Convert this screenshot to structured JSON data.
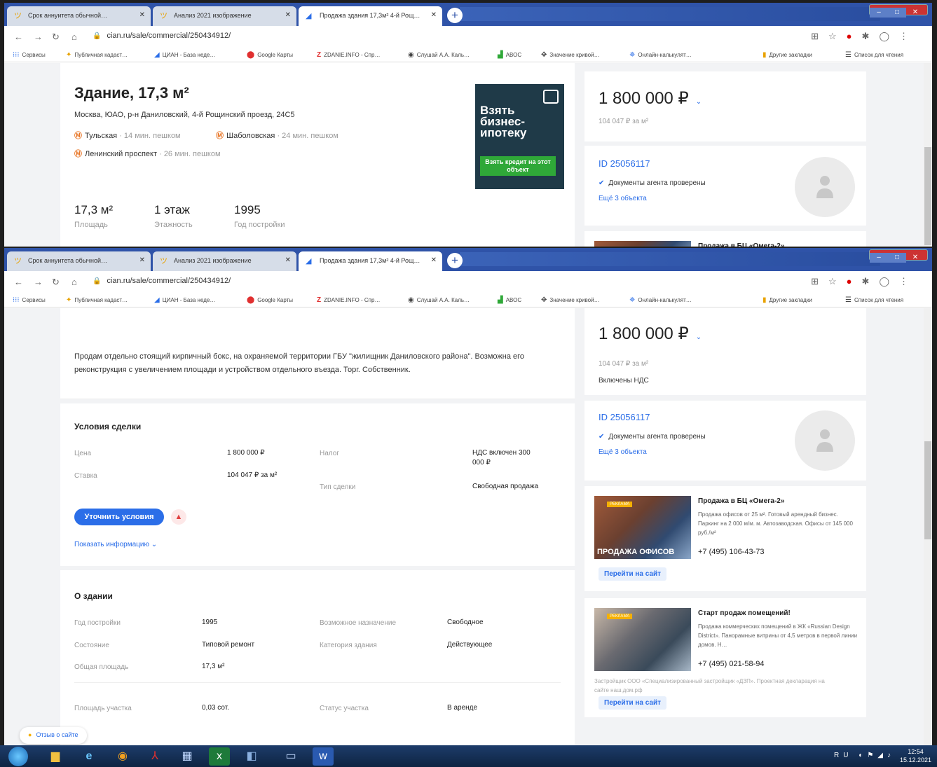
{
  "browser": {
    "tabs": [
      {
        "title": "Срок аннуитета обычной…",
        "icon": "yandex-icon"
      },
      {
        "title": "Анализ 2021 изображение",
        "icon": "yandex-icon"
      },
      {
        "title": "Продажа здания 17,3м² 4-й Рощ…",
        "icon": "cian-icon"
      }
    ],
    "address": "cian.ru/sale/commercial/250434912/",
    "bookmarks": [
      "Сервисы",
      "Публичная кадаст…",
      "ЦИАН - База неде…",
      "Google Карты",
      "ZDANIE.INFO - Спр…",
      "Слушай А.А. Каль…",
      "АВОС",
      "Значение кривой…",
      "Онлайн-калькулят…",
      "Другие закладки",
      "Список для чтения"
    ]
  },
  "listing": {
    "title": "Здание, 17,3 м²",
    "address": "Москва, ЮАО, р-н Даниловский, 4-й Рощинский проезд, 24С5",
    "metro": [
      {
        "name": "Тульская",
        "time": "· 14 мин. пешком"
      },
      {
        "name": "Шаболовская",
        "time": "· 24 мин. пешком"
      },
      {
        "name": "Ленинский проспект",
        "time": "· 26 мин. пешком"
      }
    ],
    "facts": [
      {
        "value": "17,3 м²",
        "label": "Площадь"
      },
      {
        "value": "1 этаж",
        "label": "Этажность"
      },
      {
        "value": "1995",
        "label": "Год постройки"
      }
    ],
    "description": "Продам отдельно стоящий кирпичный бокс, на охраняемой территории ГБУ \"жилищник Даниловского района\". Возможна его реконструкция с увеличением площади и устройством отдельного въезда. Торг. Собственник."
  },
  "ad_banner": {
    "text": "Взять бизнес-ипотеку",
    "button": "Взять кредит на этот объект"
  },
  "price_card": {
    "price": "1 800 000 ₽",
    "per_m2": "104 047 ₽ за м²",
    "vat": "Включены НДС",
    "id": "ID 25056117",
    "verified": "Документы агента проверены",
    "more": "Ещё 3 объекта"
  },
  "deal": {
    "title": "Условия сделки",
    "rows": [
      {
        "label": "Цена",
        "value": "1 800 000 ₽"
      },
      {
        "label": "Ставка",
        "value": "104 047 ₽ за м²"
      },
      {
        "label": "Налог",
        "value": "НДС включен 300 000 ₽"
      },
      {
        "label": "Тип сделки",
        "value": "Свободная продажа"
      }
    ],
    "button": "Уточнить условия",
    "show_more": "Показать информацию ⌄"
  },
  "building": {
    "title": "О здании",
    "rows": [
      {
        "label": "Год постройки",
        "value": "1995"
      },
      {
        "label": "Состояние",
        "value": "Типовой ремонт"
      },
      {
        "label": "Общая площадь",
        "value": "17,3 м²"
      },
      {
        "label": "Возможное назначение",
        "value": "Свободное"
      },
      {
        "label": "Категория здания",
        "value": "Действующее"
      },
      {
        "label": "Площадь участка",
        "value": "0,03 сот."
      },
      {
        "label": "Статус участка",
        "value": "В аренде"
      }
    ]
  },
  "promos": [
    {
      "tag": "РЕКЛАМА",
      "image_text": "ПРОДАЖА ОФИСОВ",
      "title": "Продажа в БЦ «Омега-2»",
      "desc": "Продажа офисов от 25 м². Готовый арендный бизнес. Паркинг на 2 000 м/м. м. Автозаводская. Офисы от 145 000 руб./м²",
      "phone": "+7 (495) 106-43-73",
      "button": "Перейти на сайт"
    },
    {
      "tag": "РЕКЛАМА",
      "title": "Старт продаж помещений!",
      "desc": "Продажа коммерческих помещений в ЖК «Russian Design District». Панорамные витрины от 4,5 метров в первой линии домов. Н…",
      "phone": "+7 (495) 021-58-94",
      "disclaimer": "Застройщик ООО «Специализированный застройщик «ДЗП». Проектная декларация на сайте наш.дом.рф",
      "button": "Перейти на сайт"
    }
  ],
  "feedback": "Отзыв о сайте",
  "taskbar": {
    "lang": "RU",
    "time": "12:54",
    "date": "15.12.2021"
  }
}
